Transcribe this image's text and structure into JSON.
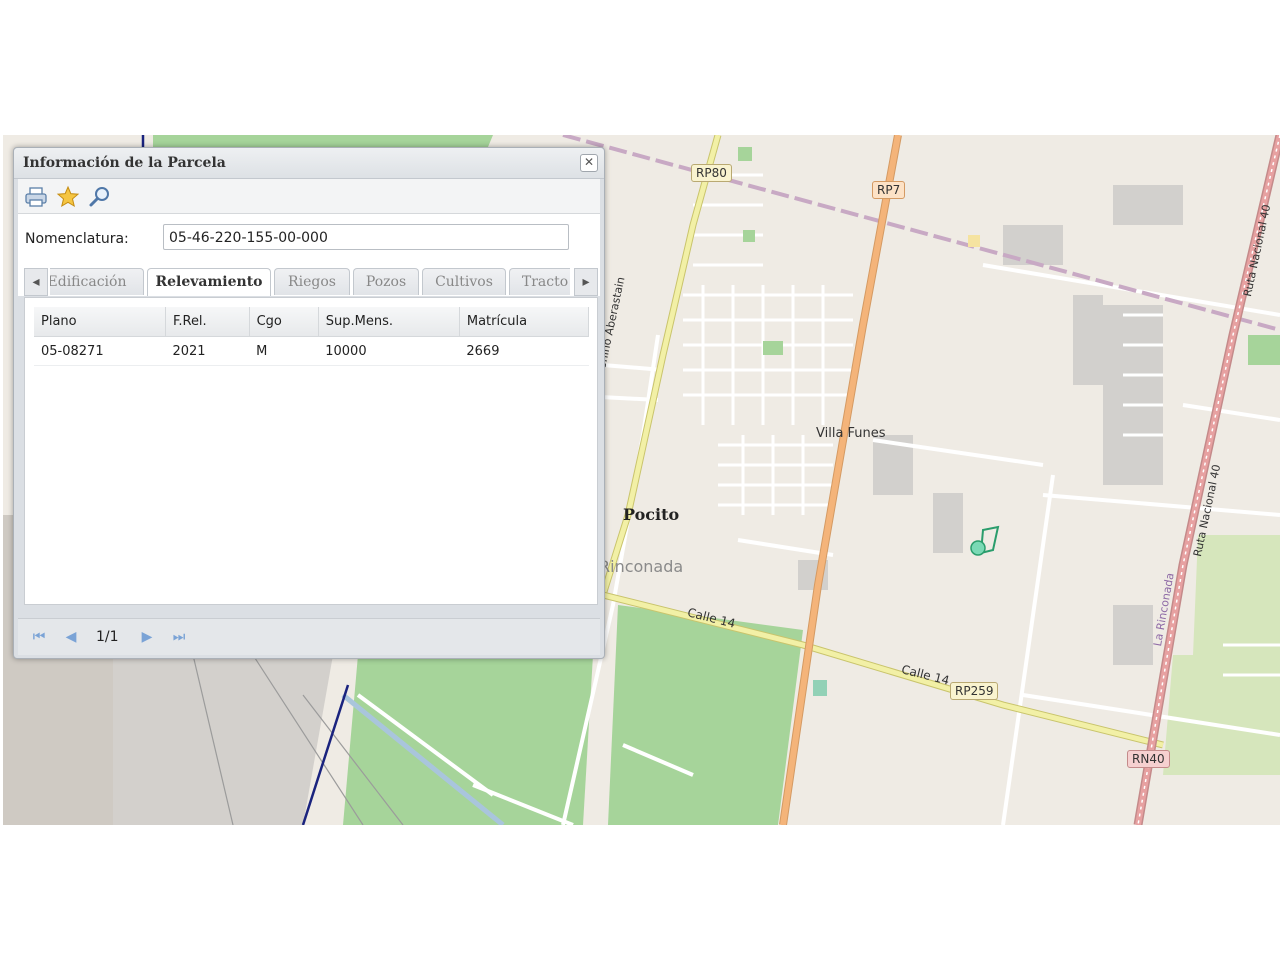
{
  "dialog": {
    "title": "Información de la Parcela",
    "close_icon": "close-icon",
    "toolbar": {
      "icons": [
        "print-icon",
        "star-icon",
        "search-icon"
      ]
    },
    "form": {
      "label": "Nomenclatura:",
      "value": "05-46-220-155-00-000"
    },
    "tabs": [
      {
        "label": "Edificación",
        "active": false
      },
      {
        "label": "Relevamiento",
        "active": true
      },
      {
        "label": "Riegos",
        "active": false
      },
      {
        "label": "Pozos",
        "active": false
      },
      {
        "label": "Cultivos",
        "active": false
      },
      {
        "label": "Tracto",
        "active": false
      }
    ],
    "table": {
      "columns": [
        "Plano",
        "F.Rel.",
        "Cgo",
        "Sup.Mens.",
        "Matrícula"
      ],
      "rows": [
        [
          "05-08271",
          "2021",
          "M",
          "10000",
          "2669"
        ]
      ]
    },
    "pager": {
      "page_info": "1/1"
    }
  },
  "map": {
    "town_labels": {
      "pocito": "Pocito",
      "rinconada": "Rinconada",
      "villa_funes": "Villa Funes"
    },
    "road_labels": {
      "rp80": "RP80",
      "rp7": "RP7",
      "rp259": "RP259",
      "rn40": "RN40",
      "calle14_a": "Calle 14",
      "calle14_b": "Calle 14",
      "ruta_nacional_40_a": "Ruta Nacional 40",
      "ruta_nacional_40_b": "Ruta Nacional 40",
      "la_rinconada": "La Rinconada",
      "avenida": "venida Antonino Aberastain"
    },
    "colors": {
      "background": "#efebe4",
      "farmland": "#a6d49a",
      "primary_road": "#f4b47a",
      "secondary_road": "#f2f0a6",
      "rail": "#c8a9c4"
    }
  }
}
